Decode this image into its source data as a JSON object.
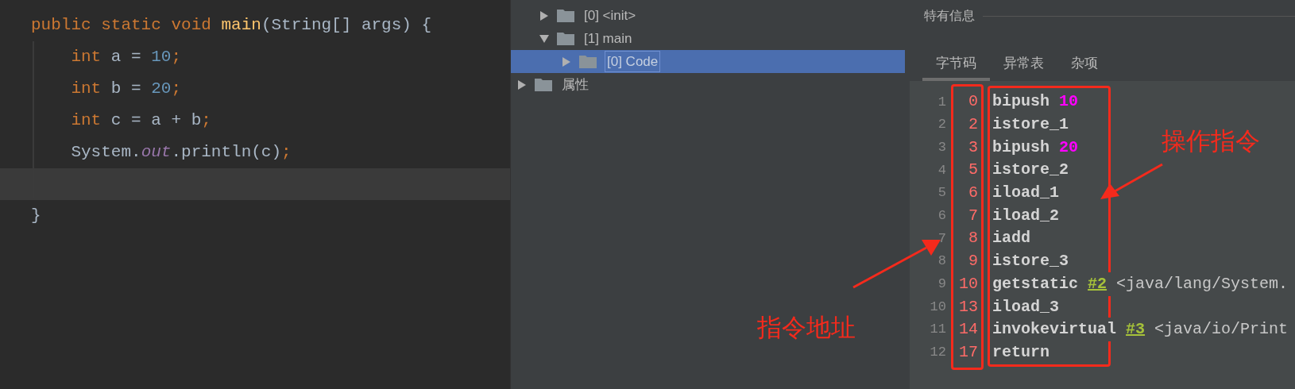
{
  "editor": {
    "lines": [
      {
        "highlighted": false,
        "tokens": [
          {
            "text": "public static void ",
            "kind": "keyword"
          },
          {
            "text": "main",
            "kind": "method"
          },
          {
            "text": "(String[] args) {",
            "kind": "plain"
          }
        ]
      },
      {
        "highlighted": false,
        "tokens": [
          {
            "text": "    int ",
            "kind": "keyword"
          },
          {
            "text": "a = ",
            "kind": "plain"
          },
          {
            "text": "10",
            "kind": "number"
          },
          {
            "text": ";",
            "kind": "keyword"
          }
        ]
      },
      {
        "highlighted": false,
        "tokens": [
          {
            "text": "    int ",
            "kind": "keyword"
          },
          {
            "text": "b = ",
            "kind": "plain"
          },
          {
            "text": "20",
            "kind": "number"
          },
          {
            "text": ";",
            "kind": "keyword"
          }
        ]
      },
      {
        "highlighted": false,
        "tokens": [
          {
            "text": "    int ",
            "kind": "keyword"
          },
          {
            "text": "c = a + b",
            "kind": "plain"
          },
          {
            "text": ";",
            "kind": "keyword"
          }
        ]
      },
      {
        "highlighted": false,
        "tokens": [
          {
            "text": "    System.",
            "kind": "plain"
          },
          {
            "text": "out",
            "kind": "field"
          },
          {
            "text": ".println(c)",
            "kind": "plain"
          },
          {
            "text": ";",
            "kind": "keyword"
          }
        ]
      },
      {
        "highlighted": true
      },
      {
        "highlighted": false,
        "tokens": [
          {
            "text": "}",
            "kind": "plain"
          }
        ]
      }
    ]
  },
  "tree": {
    "items": [
      {
        "children": [
          {
            "label": "[0] <init>",
            "expanded": false,
            "selected": false
          },
          {
            "label": "[1] main",
            "expanded": true,
            "selected": false,
            "children": [
              {
                "label": "[0] Code",
                "expanded": false,
                "selected": true
              }
            ]
          }
        ]
      },
      {
        "label": "属性",
        "expanded": false,
        "selected": false
      }
    ]
  },
  "details": {
    "title": "特有信息",
    "tabs": [
      {
        "label": "字节码",
        "selected": true
      },
      {
        "label": "异常表",
        "selected": false
      },
      {
        "label": "杂项",
        "selected": false
      }
    ],
    "bytecode": [
      {
        "line": "1",
        "address": "0",
        "tokens": [
          {
            "text": "bipush",
            "kind": "op"
          },
          {
            "text": "10",
            "kind": "operand"
          }
        ]
      },
      {
        "line": "2",
        "address": "2",
        "tokens": [
          {
            "text": "istore_1",
            "kind": "op"
          }
        ]
      },
      {
        "line": "3",
        "address": "3",
        "tokens": [
          {
            "text": "bipush",
            "kind": "op"
          },
          {
            "text": "20",
            "kind": "operand"
          }
        ]
      },
      {
        "line": "4",
        "address": "5",
        "tokens": [
          {
            "text": "istore_2",
            "kind": "op"
          }
        ]
      },
      {
        "line": "5",
        "address": "6",
        "tokens": [
          {
            "text": "iload_1",
            "kind": "op"
          }
        ]
      },
      {
        "line": "6",
        "address": "7",
        "tokens": [
          {
            "text": "iload_2",
            "kind": "op"
          }
        ]
      },
      {
        "line": "7",
        "address": "8",
        "tokens": [
          {
            "text": "iadd",
            "kind": "op"
          }
        ]
      },
      {
        "line": "8",
        "address": "9",
        "tokens": [
          {
            "text": "istore_3",
            "kind": "op"
          }
        ]
      },
      {
        "line": "9",
        "address": "10",
        "tokens": [
          {
            "text": "getstatic",
            "kind": "op"
          },
          {
            "text": "#2",
            "kind": "ref"
          },
          {
            "text": "<java/lang/System.",
            "kind": "comment"
          }
        ]
      },
      {
        "line": "10",
        "address": "13",
        "tokens": [
          {
            "text": "iload_3",
            "kind": "op"
          }
        ]
      },
      {
        "line": "11",
        "address": "14",
        "tokens": [
          {
            "text": "invokevirtual",
            "kind": "op"
          },
          {
            "text": "#3",
            "kind": "ref"
          },
          {
            "text": "<java/io/Print",
            "kind": "comment"
          }
        ]
      },
      {
        "line": "12",
        "address": "17",
        "tokens": [
          {
            "text": "return",
            "kind": "op"
          }
        ]
      }
    ]
  },
  "annotations": [
    {
      "text": "操作指令"
    },
    {
      "text": "指令地址"
    }
  ]
}
